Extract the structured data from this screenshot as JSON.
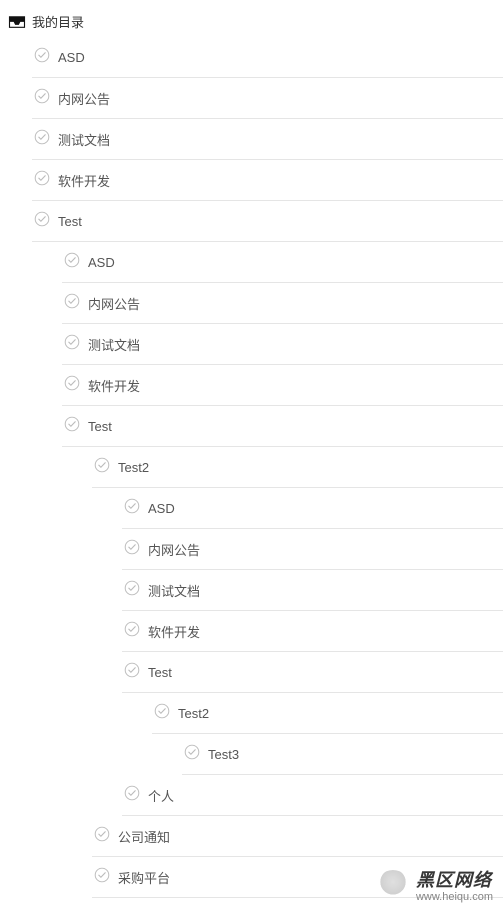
{
  "root": {
    "label": "我的目录"
  },
  "items": [
    {
      "label": "ASD",
      "depth": 1
    },
    {
      "label": "内网公告",
      "depth": 1
    },
    {
      "label": "测试文档",
      "depth": 1
    },
    {
      "label": "软件开发",
      "depth": 1
    },
    {
      "label": "Test",
      "depth": 1
    },
    {
      "label": "ASD",
      "depth": 2
    },
    {
      "label": "内网公告",
      "depth": 2
    },
    {
      "label": "测试文档",
      "depth": 2
    },
    {
      "label": "软件开发",
      "depth": 2
    },
    {
      "label": "Test",
      "depth": 2
    },
    {
      "label": "Test2",
      "depth": 3
    },
    {
      "label": "ASD",
      "depth": 4
    },
    {
      "label": "内网公告",
      "depth": 4
    },
    {
      "label": "测试文档",
      "depth": 4
    },
    {
      "label": "软件开发",
      "depth": 4
    },
    {
      "label": "Test",
      "depth": 4
    },
    {
      "label": "Test2",
      "depth": 5
    },
    {
      "label": "Test3",
      "depth": 6
    },
    {
      "label": "个人",
      "depth": 4
    },
    {
      "label": "公司通知",
      "depth": 3
    },
    {
      "label": "采购平台",
      "depth": 3
    }
  ],
  "indent": {
    "base": 24,
    "step": 30
  },
  "watermark": {
    "cn": "黑区网络",
    "url": "www.heiqu.com"
  }
}
